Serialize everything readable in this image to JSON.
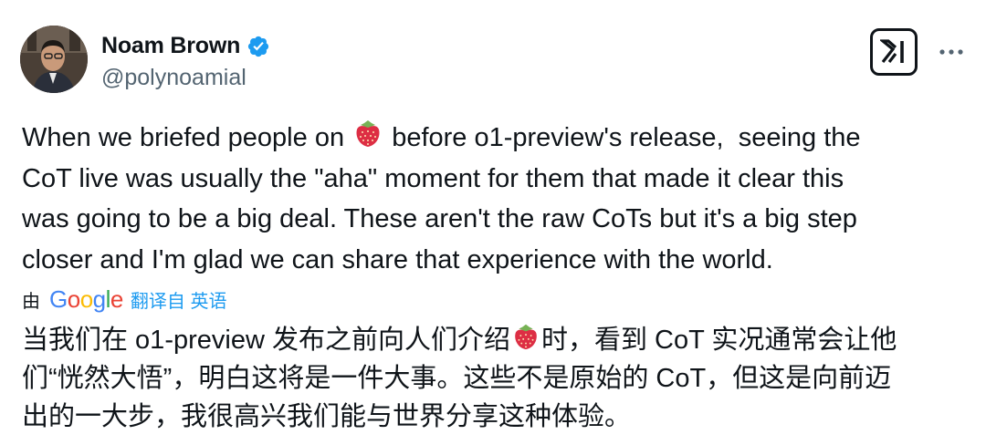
{
  "author": {
    "name": "Noam Brown",
    "handle": "@polynoamial",
    "verified": true,
    "avatar_icon": "profile-photo"
  },
  "colors": {
    "verified_blue": "#1d9bf0",
    "link_blue": "#1d9bf0",
    "handle_gray": "#536471",
    "text": "#0f1419"
  },
  "actions": {
    "x_logo_icon": "grok-logo-icon",
    "more_icon": "more-horizontal-icon"
  },
  "tweet": {
    "part1": "When we briefed people on ",
    "emoji_icon": "strawberry-emoji",
    "part2": " before o1-preview's release,  seeing the\nCoT live was usually the \"aha\" moment for them that made it clear this\nwas going to be a big deal. These aren't the raw CoTs but it's a big step\ncloser and I'm glad we can share that experience with the world."
  },
  "translation": {
    "by_label": "由",
    "google_letters": [
      "G",
      "o",
      "o",
      "g",
      "l",
      "e"
    ],
    "link_label": "翻译自 英语",
    "part1": "当我们在 o1-preview 发布之前向人们介绍",
    "emoji_icon": "strawberry-emoji",
    "part2": "时，看到 CoT 实况通常会让他\n们“恍然大悟”，明白这将是一件大事。这些不是原始的 CoT，但这是向前迈\n出的一大步，我很高兴我们能与世界分享这种体验。"
  }
}
